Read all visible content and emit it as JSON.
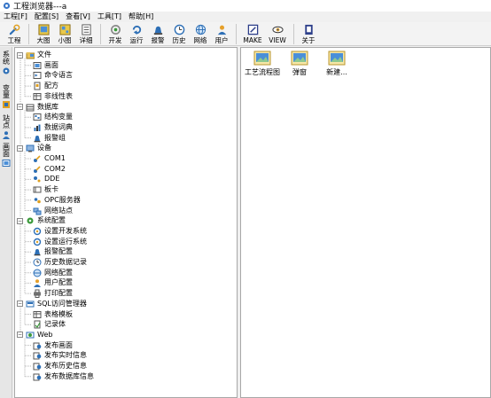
{
  "window": {
    "title": "工程浏览器---a"
  },
  "menu": [
    "工程[F]",
    "配置[S]",
    "查看[V]",
    "工具[T]",
    "帮助[H]"
  ],
  "toolbar": {
    "group1": [
      {
        "label": "工程",
        "icon": "wrench-icon"
      }
    ],
    "group2": [
      {
        "label": "大图",
        "icon": "large-icons-icon"
      },
      {
        "label": "小图",
        "icon": "small-icons-icon"
      },
      {
        "label": "详细",
        "icon": "details-icon"
      }
    ],
    "group3": [
      {
        "label": "开发",
        "icon": "develop-icon"
      },
      {
        "label": "运行",
        "icon": "run-icon"
      },
      {
        "label": "报警",
        "icon": "alarm-icon"
      },
      {
        "label": "历史",
        "icon": "history-icon"
      },
      {
        "label": "网络",
        "icon": "network-icon"
      },
      {
        "label": "用户",
        "icon": "user-icon"
      }
    ],
    "group4": [
      {
        "label": "MAKE",
        "icon": "make-icon"
      },
      {
        "label": "VIEW",
        "icon": "view-icon"
      }
    ],
    "group5": [
      {
        "label": "关于",
        "icon": "about-icon"
      }
    ]
  },
  "side_tabs": [
    "系统",
    "变量",
    "站点",
    "画面"
  ],
  "tree": {
    "root_nodes": [
      {
        "label": "文件",
        "children": [
          "画面",
          "命令语言",
          "配方",
          "非线性表"
        ]
      },
      {
        "label": "数据库",
        "children": [
          "结构变量",
          "数据词典",
          "报警组"
        ]
      },
      {
        "label": "设备",
        "children": [
          "COM1",
          "COM2",
          "DDE",
          "板卡",
          "OPC服务器",
          "网络站点"
        ]
      },
      {
        "label": "系统配置",
        "children": [
          "设置开发系统",
          "设置运行系统",
          "报警配置",
          "历史数据记录",
          "网络配置",
          "用户配置",
          "打印配置"
        ]
      },
      {
        "label": "SQL访问管理器",
        "children": [
          "表格模板",
          "记录体"
        ]
      },
      {
        "label": "Web",
        "children": [
          "发布画面",
          "发布实时信息",
          "发布历史信息",
          "发布数据库信息"
        ]
      }
    ]
  },
  "content": {
    "items": [
      "工艺流程图",
      "弹窗",
      "新建..."
    ]
  },
  "colors": {
    "accent": "#2d6fb6",
    "toolbar_bg": "#f3f3f3",
    "window_bg": "#f0f0f0"
  }
}
